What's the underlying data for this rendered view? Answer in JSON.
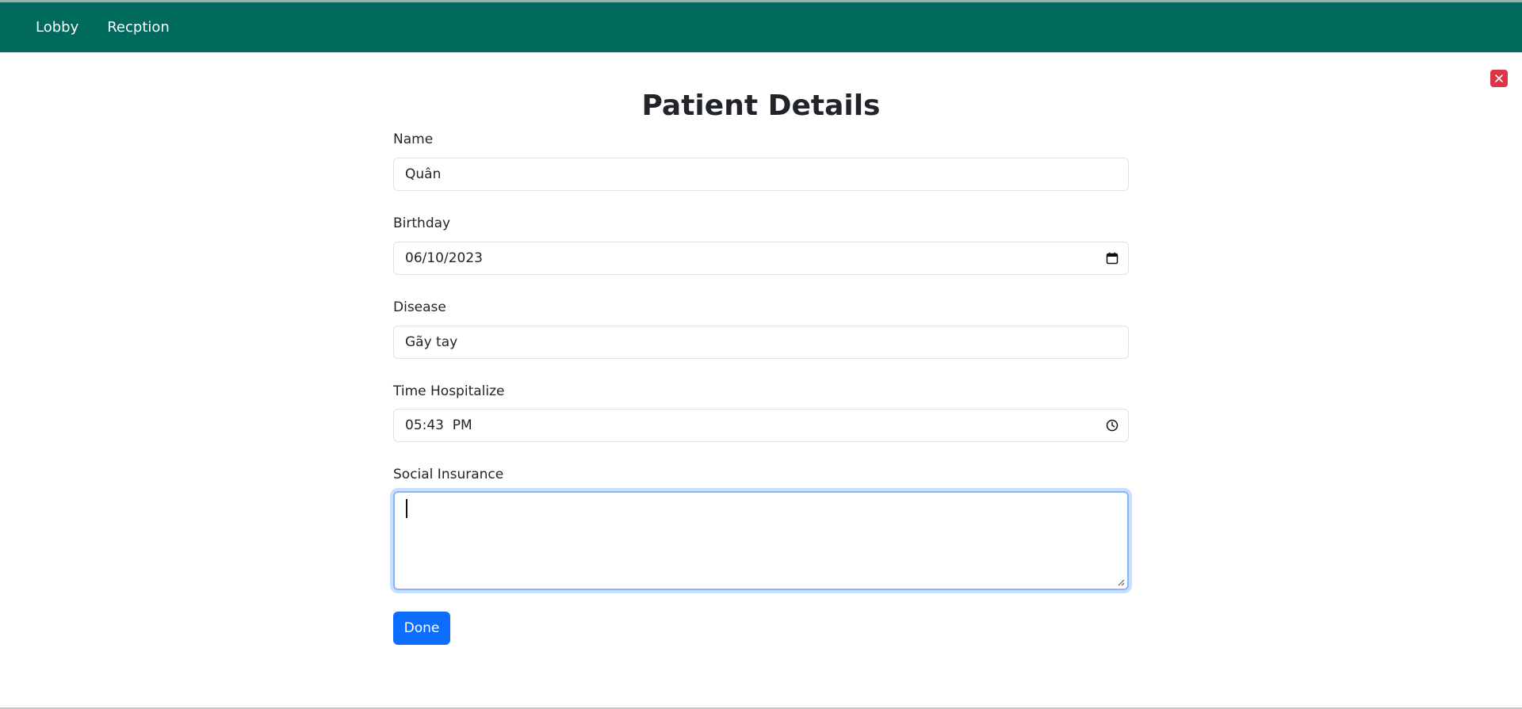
{
  "nav": {
    "items": [
      {
        "label": "Lobby"
      },
      {
        "label": "Recption"
      }
    ]
  },
  "page": {
    "title": "Patient Details"
  },
  "form": {
    "name": {
      "label": "Name",
      "value": "Quân"
    },
    "birthday": {
      "label": "Birthday",
      "value": "06/10/2023"
    },
    "disease": {
      "label": "Disease",
      "value": "Gãy tay"
    },
    "time_hospitalize": {
      "label": "Time Hospitalize",
      "value": "05:43  PM"
    },
    "social_insurance": {
      "label": "Social Insurance",
      "value": ""
    },
    "submit_label": "Done"
  },
  "icons": {
    "close": "close-icon",
    "calendar": "calendar-icon",
    "clock": "clock-icon",
    "resize": "resize-grip-icon"
  },
  "colors": {
    "navbar": "#006a5c",
    "primary": "#0d6efd",
    "danger": "#dc3545",
    "focus_border": "#86b7fe"
  }
}
